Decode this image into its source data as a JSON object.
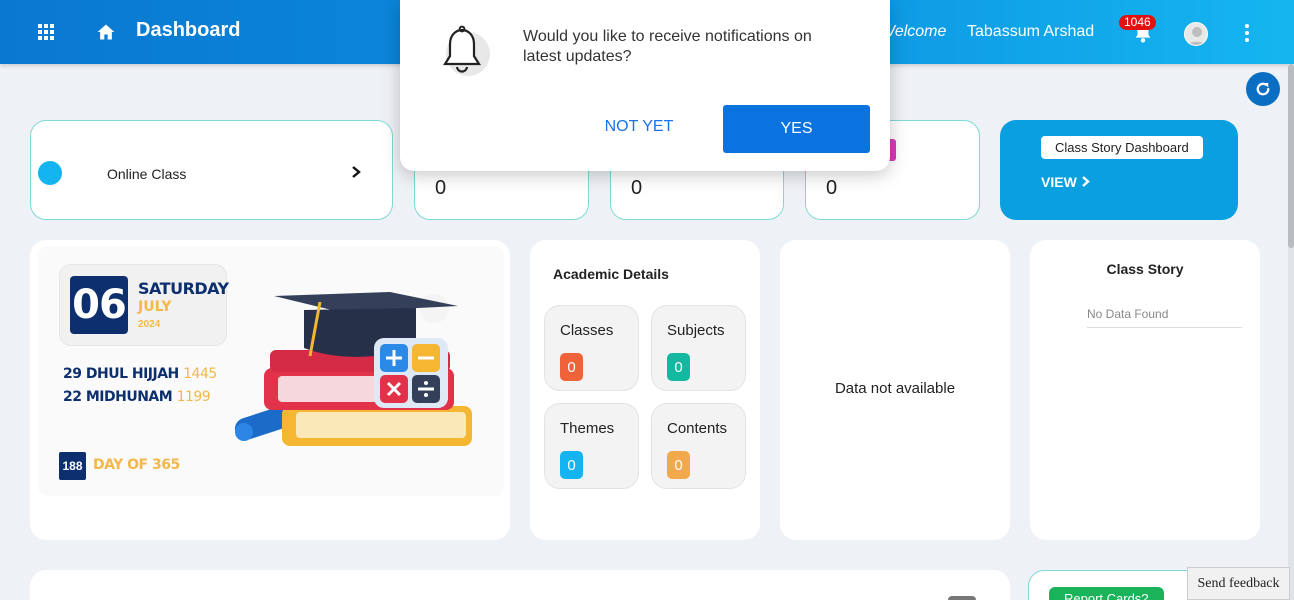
{
  "header": {
    "title": "Dashboard",
    "welcome": "Welcome",
    "username": "Tabassum Arshad",
    "notification_count": "1046",
    "brand_color": "#0a78d0"
  },
  "top_cards": {
    "online_class": {
      "label": "Online Class"
    },
    "stats": [
      {
        "value": "0"
      },
      {
        "value": "0"
      },
      {
        "value": "0"
      }
    ],
    "class_story": {
      "button": "Class Story Dashboard",
      "view": "VIEW"
    }
  },
  "date_card": {
    "day": "06",
    "weekday": "SATURDAY",
    "month": "JULY",
    "year": "2024",
    "hijri_text": "29 DHUL HIJJAH",
    "hijri_year": "1445",
    "malayalam_text": "22 MIDHUNAM",
    "malayalam_year": "1199",
    "day_of_year": "188",
    "day_of_year_label": "DAY OF 365"
  },
  "academic": {
    "title": "Academic Details",
    "tiles": [
      {
        "label": "Classes",
        "value": "0",
        "color": "#f0633a"
      },
      {
        "label": "Subjects",
        "value": "0",
        "color": "#12b8a0"
      },
      {
        "label": "Themes",
        "value": "0",
        "color": "#14b4f0"
      },
      {
        "label": "Contents",
        "value": "0",
        "color": "#f2a94b"
      }
    ]
  },
  "data_panel": {
    "text": "Data not available"
  },
  "class_story_panel": {
    "title": "Class Story",
    "empty": "No Data Found"
  },
  "report": {
    "button": "Report Cards?"
  },
  "feedback": {
    "label": "Send feedback"
  },
  "notification_prompt": {
    "message": "Would you like to receive notifications on latest updates?",
    "decline": "NOT YET",
    "accept": "YES"
  }
}
